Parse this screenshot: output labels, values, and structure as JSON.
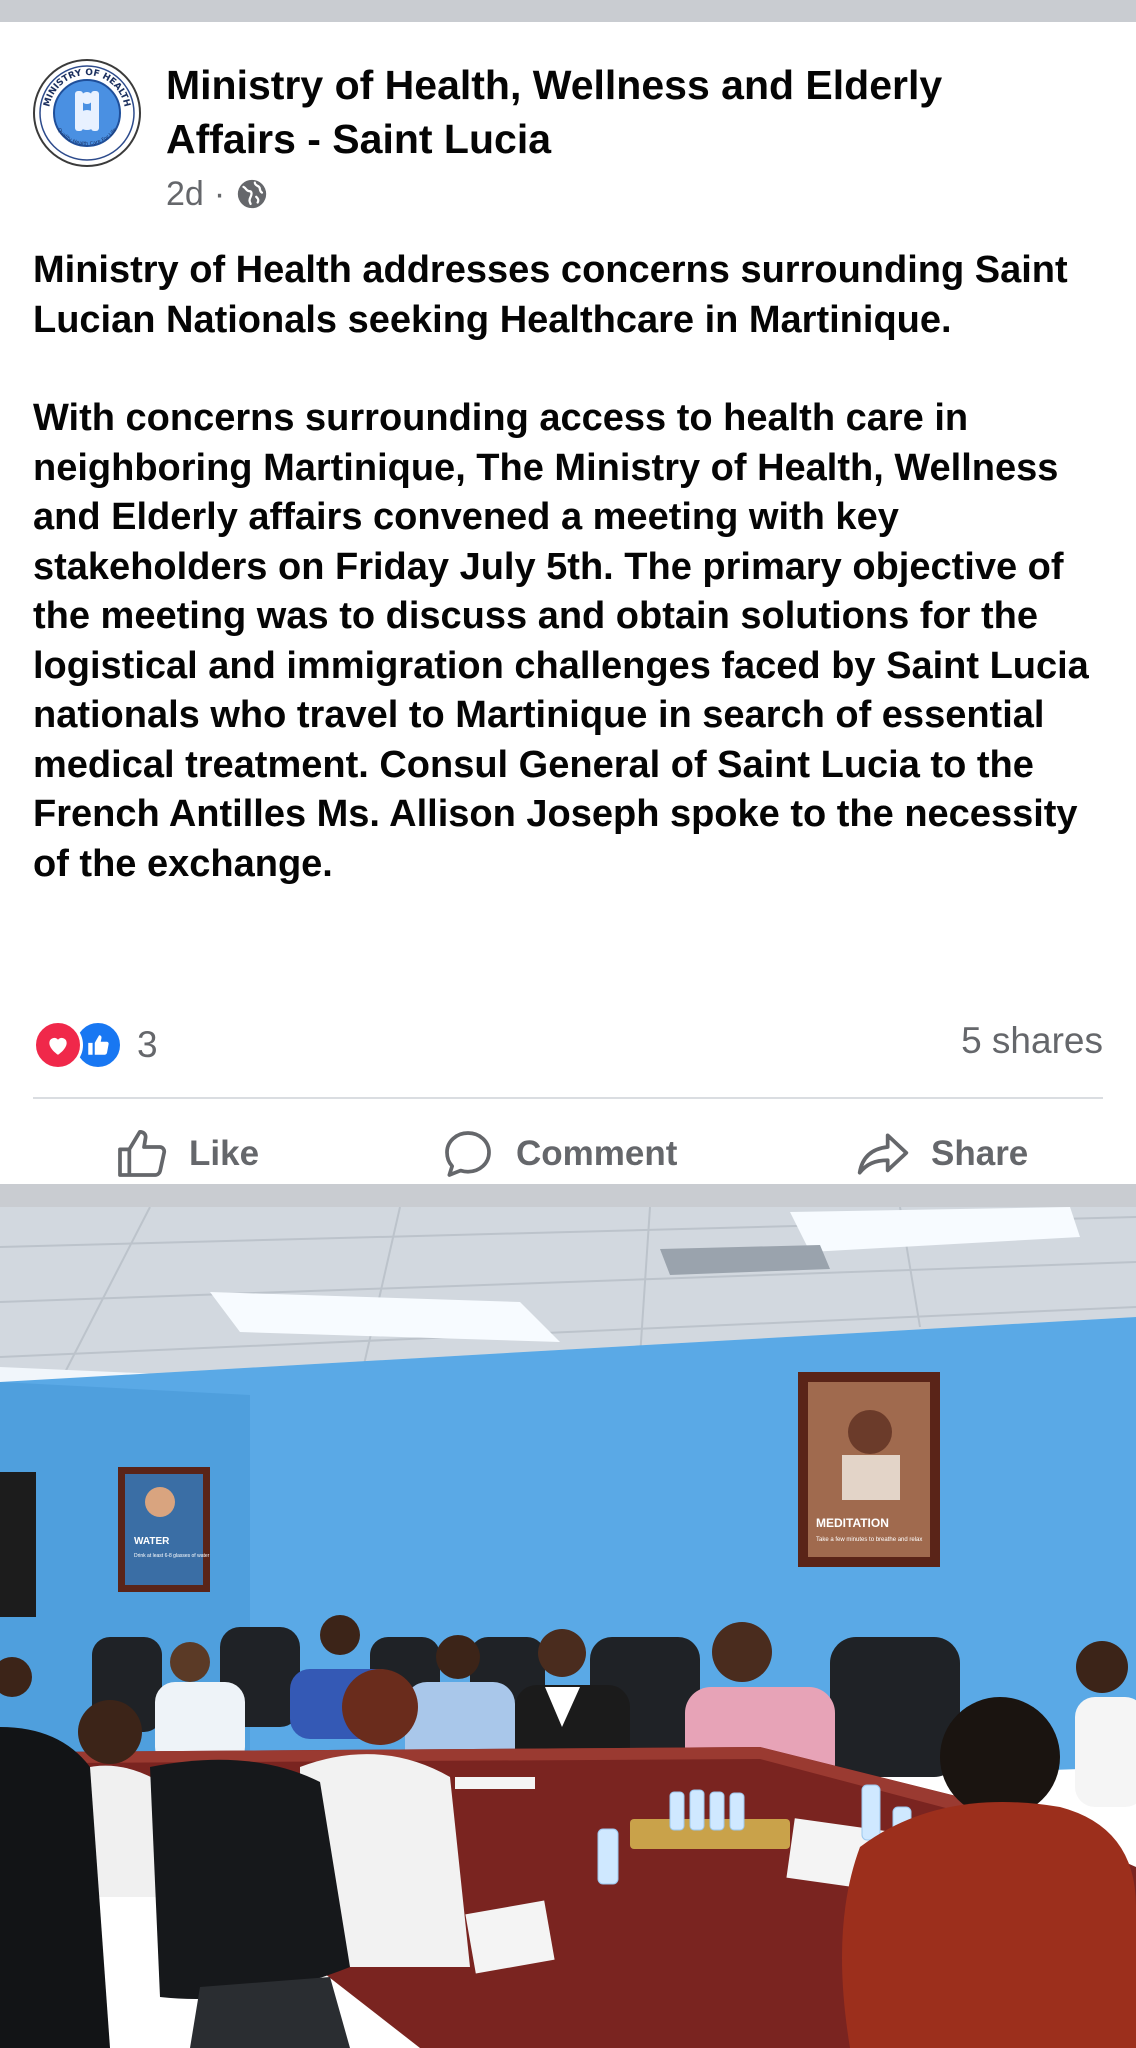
{
  "post": {
    "page_name": "Ministry of Health, Wellness and Elderly Affairs - Saint Lucia",
    "time": "2d",
    "separator": "·",
    "audience_icon": "globe-icon",
    "avatar": {
      "logo_text_top": "MINISTRY OF HEALTH",
      "logo_text_bottom": "Quality Health Care For Life"
    },
    "headline": "Ministry of Health addresses concerns surrounding Saint Lucian Nationals seeking Healthcare in Martinique.",
    "body": "With concerns surrounding access to health care in neighboring Martinique, The Ministry of Health, Wellness and Elderly affairs convened a meeting with key stakeholders on Friday July 5th. The primary objective of the meeting was to discuss and obtain solutions for the logistical and immigration challenges faced by Saint Lucia nationals who travel to Martinique in search of essential medical treatment. Consul General of Saint Lucia to the French Antilles Ms. Allison Joseph spoke to the necessity of the exchange.",
    "reaction_icons": [
      "love-reaction-icon",
      "like-reaction-icon"
    ],
    "reaction_count": "3",
    "shares": "5 shares"
  },
  "actions": {
    "like": "Like",
    "comment": "Comment",
    "share": "Share"
  },
  "photo": {
    "poster_left": {
      "title": "WATER",
      "text": "Drink at least 6-8 glasses of water"
    },
    "poster_right": {
      "title": "MEDITATION",
      "text": "Take a few minutes to breathe and relax"
    }
  },
  "colors": {
    "text_primary": "#050505",
    "text_secondary": "#65676b",
    "love": "#f0284a",
    "like": "#1877f2",
    "feed_background": "#c9ccd1",
    "wall": "#5aa9e6",
    "table": "#7a2420"
  }
}
